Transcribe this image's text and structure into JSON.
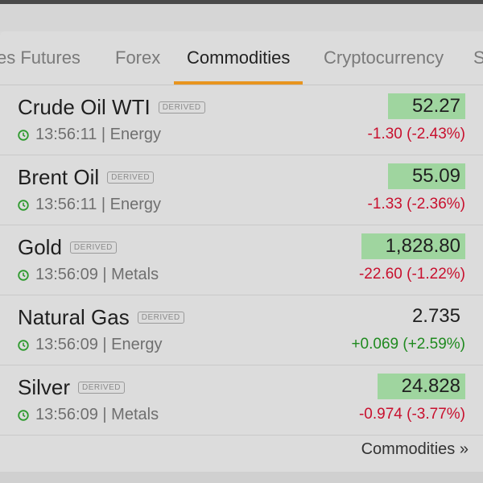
{
  "tabs": [
    {
      "label": "es Futures",
      "active": false
    },
    {
      "label": "Forex",
      "active": false
    },
    {
      "label": "Commodities",
      "active": true
    },
    {
      "label": "Cryptocurrency",
      "active": false
    },
    {
      "label": "S",
      "active": false
    }
  ],
  "badge_label": "DERIVED",
  "rows": [
    {
      "name": "Crude Oil WTI",
      "time": "13:56:11 | Energy",
      "price": "52.27",
      "change": "-1.30 (-2.43%)",
      "direction": "neg",
      "highlight": true
    },
    {
      "name": "Brent Oil",
      "time": "13:56:11 | Energy",
      "price": "55.09",
      "change": "-1.33 (-2.36%)",
      "direction": "neg",
      "highlight": true
    },
    {
      "name": "Gold",
      "time": "13:56:09 | Metals",
      "price": "1,828.80",
      "change": "-22.60 (-1.22%)",
      "direction": "neg",
      "highlight": true
    },
    {
      "name": "Natural Gas",
      "time": "13:56:09 | Energy",
      "price": "2.735",
      "change": "+0.069 (+2.59%)",
      "direction": "pos",
      "highlight": false
    },
    {
      "name": "Silver",
      "time": "13:56:09 | Metals",
      "price": "24.828",
      "change": "-0.974 (-3.77%)",
      "direction": "neg",
      "highlight": true
    }
  ],
  "footer_link": "Commodities »",
  "colors": {
    "accent": "#e8951f",
    "negative": "#c8102e",
    "positive": "#1f8a1f",
    "highlight": "#9fd59f",
    "clock": "#2e9a2e"
  }
}
